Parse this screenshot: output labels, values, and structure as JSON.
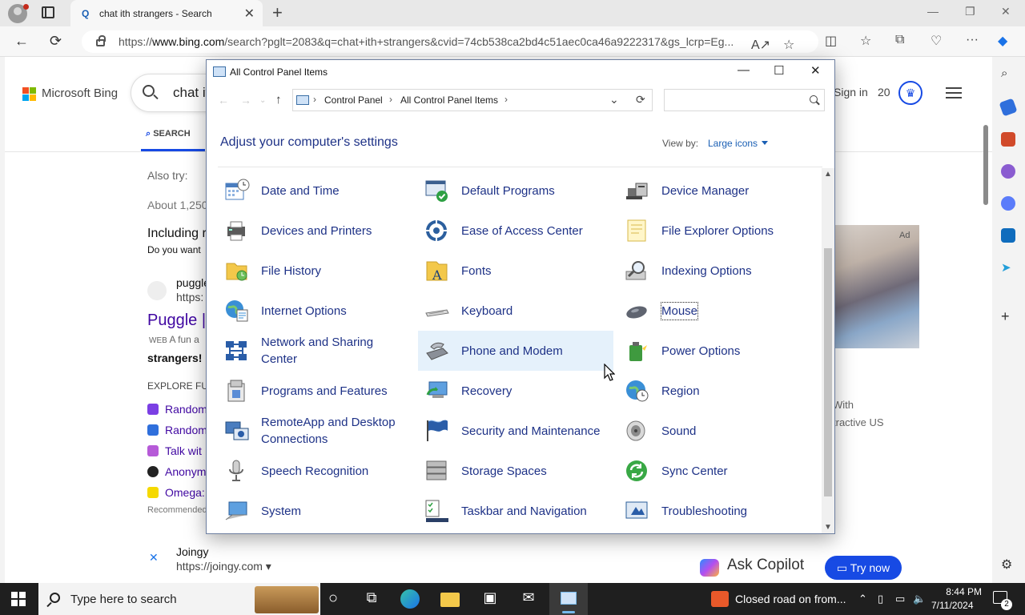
{
  "browser": {
    "tab_title": "chat ith strangers - Search",
    "url_prefix": "https://",
    "url_host": "www.bing.com",
    "url_rest": "/search?pglt=2083&q=chat+ith+strangers&cvid=74cb538ca2bd4c51aec0ca46a9222317&gs_lcrp=Eg..."
  },
  "bing": {
    "brand": "Microsoft Bing",
    "query": "chat it",
    "sign_in": "Sign in",
    "points": "20",
    "search_tab": "SEARCH",
    "also_try": "Also try:",
    "about": "About 1,250",
    "including": "Including r",
    "do_you_want": "Do you want",
    "result1_name": "puggle",
    "result1_url": "https:",
    "result1_title": "Puggle |",
    "result1_snippet_prefix": "WEB",
    "result1_snippet": "A fun a",
    "result1_bold": "strangers! N",
    "explore": "EXPLORE FU",
    "related": [
      "Random",
      "Random",
      "Talk wit",
      "Anonym",
      "Omega:"
    ],
    "recommended": "Recommended",
    "result2_name": "Joingy",
    "result2_url": "https://joingy.com",
    "ad_label": "Ad",
    "ad_text1": "With",
    "ad_text2": "tractive US",
    "ask_copilot": "Ask Copilot",
    "try_now": "Try now"
  },
  "control_panel": {
    "window_title": "All Control Panel Items",
    "breadcrumb": [
      "Control Panel",
      "All Control Panel Items"
    ],
    "search_placeholder": "",
    "heading": "Adjust your computer's settings",
    "view_by_label": "View by:",
    "view_by_value": "Large icons",
    "items": [
      {
        "label": "Date and Time",
        "icon": "calendar-clock-icon"
      },
      {
        "label": "Default Programs",
        "icon": "default-programs-icon"
      },
      {
        "label": "Device Manager",
        "icon": "device-manager-icon"
      },
      {
        "label": "Devices and Printers",
        "icon": "printer-icon"
      },
      {
        "label": "Ease of Access Center",
        "icon": "ease-of-access-icon"
      },
      {
        "label": "File Explorer Options",
        "icon": "folder-options-icon"
      },
      {
        "label": "File History",
        "icon": "file-history-icon"
      },
      {
        "label": "Fonts",
        "icon": "fonts-icon"
      },
      {
        "label": "Indexing Options",
        "icon": "indexing-icon"
      },
      {
        "label": "Internet Options",
        "icon": "globe-icon"
      },
      {
        "label": "Keyboard",
        "icon": "keyboard-icon"
      },
      {
        "label": "Mouse",
        "icon": "mouse-icon"
      },
      {
        "label": "Network and Sharing Center",
        "icon": "network-icon"
      },
      {
        "label": "Phone and Modem",
        "icon": "phone-modem-icon"
      },
      {
        "label": "Power Options",
        "icon": "power-options-icon"
      },
      {
        "label": "Programs and Features",
        "icon": "programs-icon"
      },
      {
        "label": "Recovery",
        "icon": "recovery-icon"
      },
      {
        "label": "Region",
        "icon": "region-icon"
      },
      {
        "label": "RemoteApp and Desktop Connections",
        "icon": "remoteapp-icon"
      },
      {
        "label": "Security and Maintenance",
        "icon": "flag-icon"
      },
      {
        "label": "Sound",
        "icon": "speaker-icon"
      },
      {
        "label": "Speech Recognition",
        "icon": "microphone-icon"
      },
      {
        "label": "Storage Spaces",
        "icon": "storage-icon"
      },
      {
        "label": "Sync Center",
        "icon": "sync-icon"
      },
      {
        "label": "System",
        "icon": "system-icon"
      },
      {
        "label": "Taskbar and Navigation",
        "icon": "taskbar-icon"
      },
      {
        "label": "Troubleshooting",
        "icon": "troubleshooting-icon"
      }
    ]
  },
  "taskbar": {
    "search_text": "Type here to search",
    "news": "Closed road on from...",
    "time": "8:44 PM",
    "date": "7/11/2024",
    "notification_count": "2"
  }
}
